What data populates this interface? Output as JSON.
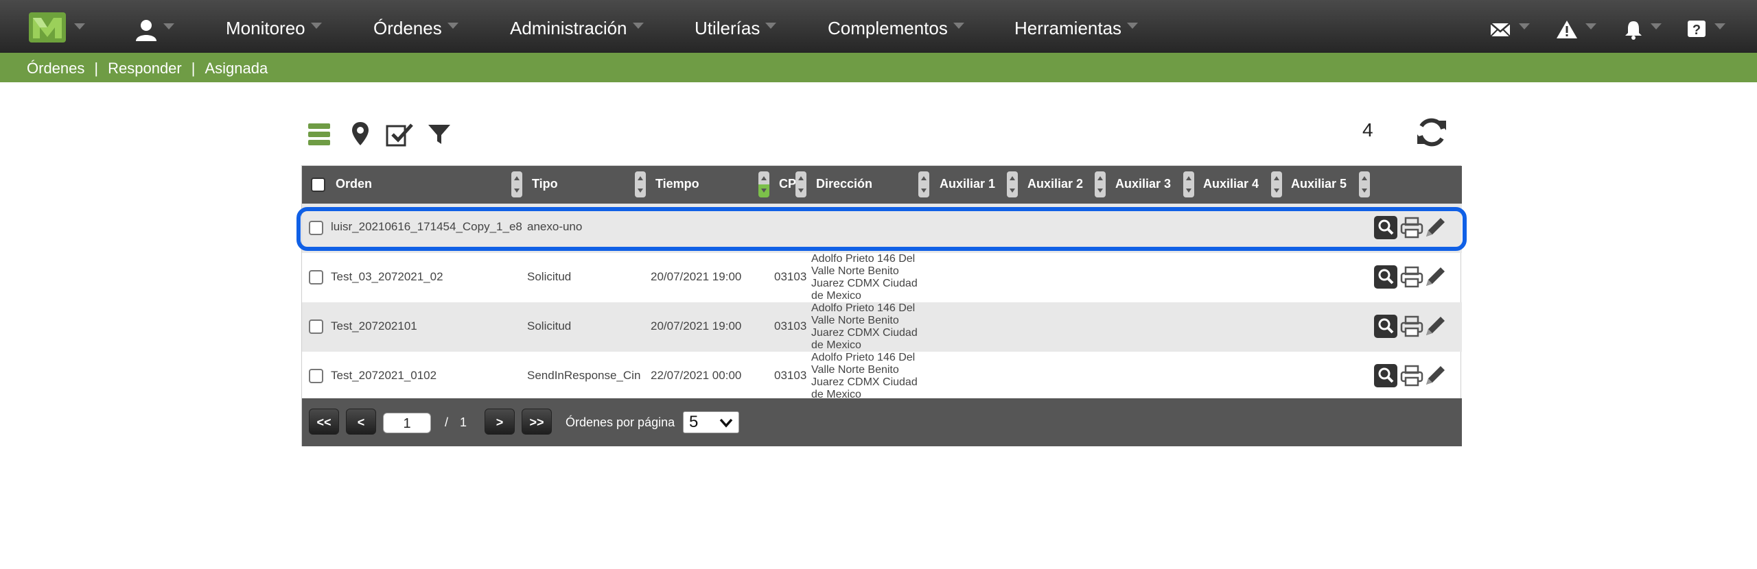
{
  "nav": {
    "items": [
      {
        "label": "Monitoreo"
      },
      {
        "label": "Órdenes"
      },
      {
        "label": "Administración"
      },
      {
        "label": "Utilerías"
      },
      {
        "label": "Complementos"
      },
      {
        "label": "Herramientas"
      }
    ],
    "right_icons": [
      "mail-icon",
      "warning-icon",
      "bell-icon",
      "help-icon"
    ]
  },
  "breadcrumb": {
    "items": [
      "Órdenes",
      "Responder",
      "Asignada"
    ],
    "separator": "|"
  },
  "toolbar": {
    "icons": [
      "list-icon",
      "map-pin-icon",
      "assign-check-icon",
      "filter-icon"
    ],
    "count": "4"
  },
  "table": {
    "columns": [
      "Orden",
      "Tipo",
      "Tiempo",
      "CP",
      "Dirección",
      "Auxiliar 1",
      "Auxiliar 2",
      "Auxiliar 3",
      "Auxiliar 4",
      "Auxiliar 5"
    ],
    "rows": [
      {
        "orden": "luisr_20210616_171454_Copy_1_e8",
        "tipo": "anexo-uno",
        "tiempo": "",
        "cp": "",
        "direccion": ""
      },
      {
        "orden": "Test_03_2072021_02",
        "tipo": "Solicitud",
        "tiempo": "20/07/2021 19:00",
        "cp": "03103",
        "direccion": "Adolfo Prieto 146 Del Valle Norte Benito Juarez CDMX Ciudad de Mexico"
      },
      {
        "orden": "Test_207202101",
        "tipo": "Solicitud",
        "tiempo": "20/07/2021 19:00",
        "cp": "03103",
        "direccion": "Adolfo Prieto 146 Del Valle Norte Benito Juarez CDMX Ciudad de Mexico"
      },
      {
        "orden": "Test_2072021_0102",
        "tipo": "SendInResponse_Cin",
        "tiempo": "22/07/2021 00:00",
        "cp": "03103",
        "direccion": "Adolfo Prieto 146 Del Valle Norte Benito Juarez CDMX Ciudad de Mexico"
      }
    ],
    "row_actions": [
      "search-icon",
      "print-icon",
      "edit-icon"
    ]
  },
  "pager": {
    "first": "<<",
    "prev": "<",
    "page": "1",
    "of": "/",
    "total_pages": "1",
    "next": ">",
    "last": ">>",
    "per_page_label": "Órdenes por página",
    "per_page": "5"
  },
  "colors": {
    "topbar": "#2e2e2e",
    "accent_green": "#6f9c45",
    "header_gray": "#565656",
    "highlight_blue": "#1060e6"
  }
}
